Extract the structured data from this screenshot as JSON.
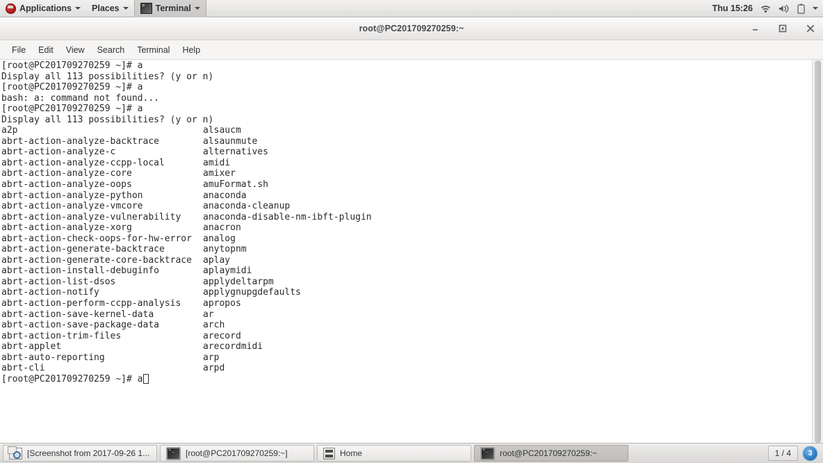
{
  "top_panel": {
    "applications_label": "Applications",
    "places_label": "Places",
    "active_app_label": "Terminal",
    "clock": "Thu 15:26",
    "tray_icons": [
      "wifi-icon",
      "volume-icon",
      "battery-icon",
      "chevron-down-icon"
    ]
  },
  "window": {
    "title": "root@PC201709270259:~",
    "controls": {
      "minimize": "–",
      "maximize": "□",
      "close": "✕"
    },
    "menubar": [
      "File",
      "Edit",
      "View",
      "Search",
      "Terminal",
      "Help"
    ]
  },
  "terminal": {
    "prompt": "[root@PC201709270259 ~]# ",
    "header_lines": [
      "[root@PC201709270259 ~]# a",
      "Display all 113 possibilities? (y or n)",
      "[root@PC201709270259 ~]# a",
      "bash: a: command not found...",
      "[root@PC201709270259 ~]# a",
      "Display all 113 possibilities? (y or n)"
    ],
    "completion_rows": [
      [
        "a2p",
        "alsaucm"
      ],
      [
        "abrt-action-analyze-backtrace",
        "alsaunmute"
      ],
      [
        "abrt-action-analyze-c",
        "alternatives"
      ],
      [
        "abrt-action-analyze-ccpp-local",
        "amidi"
      ],
      [
        "abrt-action-analyze-core",
        "amixer"
      ],
      [
        "abrt-action-analyze-oops",
        "amuFormat.sh"
      ],
      [
        "abrt-action-analyze-python",
        "anaconda"
      ],
      [
        "abrt-action-analyze-vmcore",
        "anaconda-cleanup"
      ],
      [
        "abrt-action-analyze-vulnerability",
        "anaconda-disable-nm-ibft-plugin"
      ],
      [
        "abrt-action-analyze-xorg",
        "anacron"
      ],
      [
        "abrt-action-check-oops-for-hw-error",
        "analog"
      ],
      [
        "abrt-action-generate-backtrace",
        "anytopnm"
      ],
      [
        "abrt-action-generate-core-backtrace",
        "aplay"
      ],
      [
        "abrt-action-install-debuginfo",
        "aplaymidi"
      ],
      [
        "abrt-action-list-dsos",
        "applydeltarpm"
      ],
      [
        "abrt-action-notify",
        "applygnupgdefaults"
      ],
      [
        "abrt-action-perform-ccpp-analysis",
        "apropos"
      ],
      [
        "abrt-action-save-kernel-data",
        "ar"
      ],
      [
        "abrt-action-save-package-data",
        "arch"
      ],
      [
        "abrt-action-trim-files",
        "arecord"
      ],
      [
        "abrt-applet",
        "arecordmidi"
      ],
      [
        "abrt-auto-reporting",
        "arp"
      ],
      [
        "abrt-cli",
        "arpd"
      ]
    ],
    "current_input": "a",
    "possibilities_count": "113"
  },
  "taskbar": {
    "tasks": [
      {
        "label": "[Screenshot from 2017-09-26 1...",
        "icon": "screenshot-icon",
        "active": false
      },
      {
        "label": "[root@PC201709270259:~]",
        "icon": "terminal-icon",
        "active": false
      },
      {
        "label": "Home",
        "icon": "home-icon",
        "active": false
      },
      {
        "label": "root@PC201709270259:~",
        "icon": "terminal-icon",
        "active": true
      }
    ],
    "workspace": "1 / 4",
    "notification_count": "3"
  },
  "colors": {
    "panel_bg": "#e8e7e6",
    "terminal_bg": "#ffffff",
    "terminal_fg": "#2b2b2b",
    "title_fg": "#43484b",
    "badge_blue": "#2d7dc4"
  }
}
